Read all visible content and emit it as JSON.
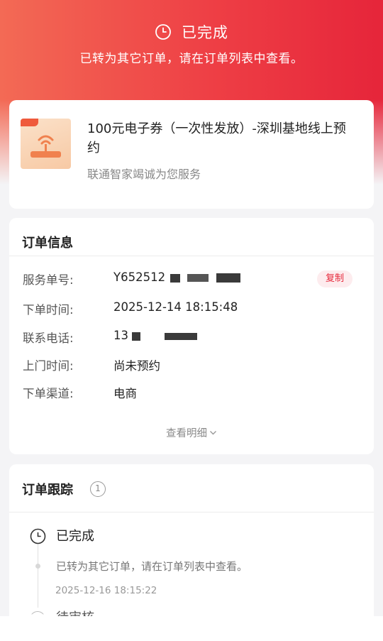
{
  "header": {
    "status_icon": "clock-icon",
    "status_title": "已完成",
    "status_desc": "已转为其它订单，请在订单列表中查看。",
    "accent_color": "#ee3f45"
  },
  "product": {
    "title": "100元电子券（一次性发放）-深圳基地线上预约",
    "subtitle": "联通智家竭诚为您服务",
    "thumb_icon": "wifi-router-icon"
  },
  "order_info": {
    "section_title": "订单信息",
    "rows": [
      {
        "label": "服务单号:",
        "value": "Y652512"
      },
      {
        "label": "下单时间:",
        "value": "2025-12-14 18:15:48"
      },
      {
        "label": "联系电话:",
        "value": "13"
      },
      {
        "label": "上门时间:",
        "value": "尚未预约"
      },
      {
        "label": "下单渠道:",
        "value": "电商"
      }
    ],
    "copy_label": "复制",
    "detail_link": "查看明细"
  },
  "tracking": {
    "section_title": "订单跟踪",
    "count": "1",
    "events": [
      {
        "title": "已完成",
        "desc": "已转为其它订单，请在订单列表中查看。",
        "time": "2025-12-16 18:15:22"
      }
    ],
    "next_title": "待审核"
  }
}
